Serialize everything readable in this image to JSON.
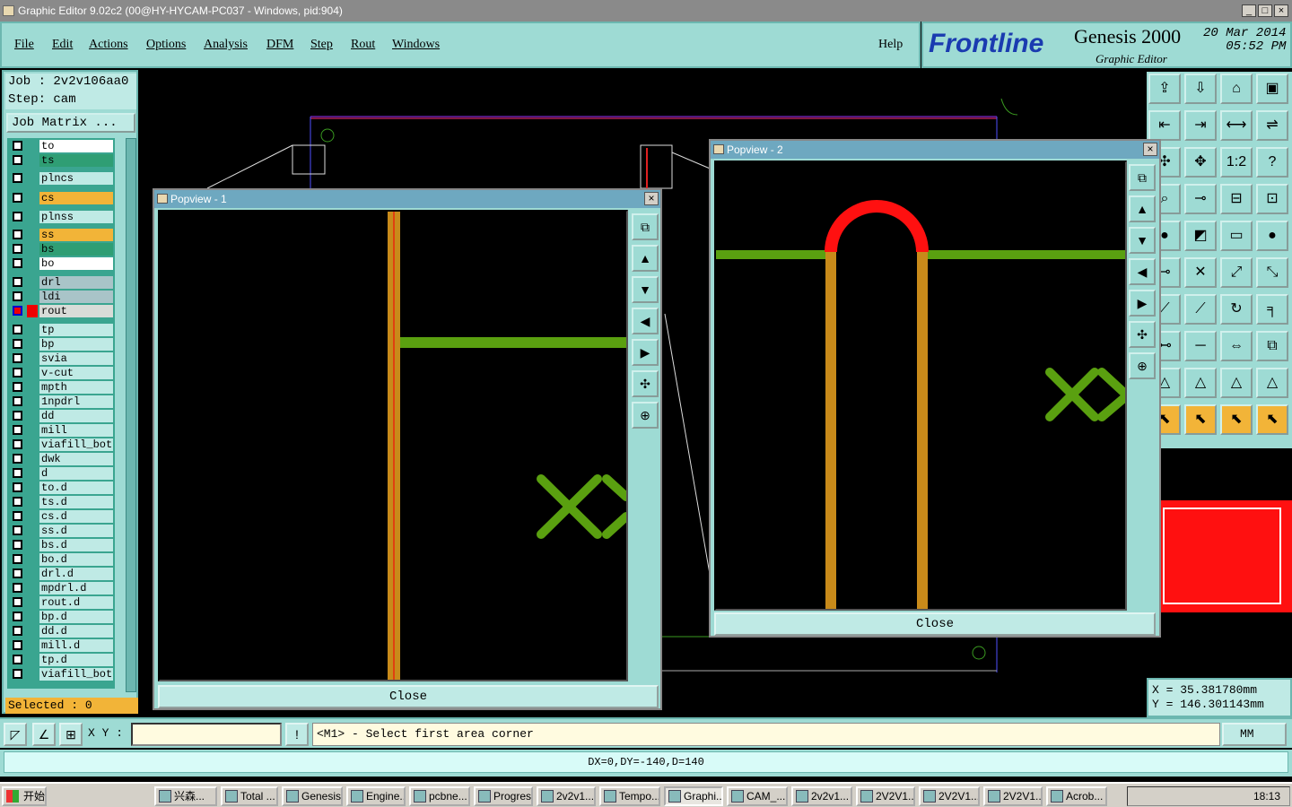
{
  "window": {
    "title": "Graphic Editor 9.02c2 (00@HY-HYCAM-PC037 - Windows, pid:904)",
    "buttons": [
      "_",
      "□",
      "×"
    ]
  },
  "menu": {
    "items": [
      "File",
      "Edit",
      "Actions",
      "Options",
      "Analysis",
      "DFM",
      "Step",
      "Rout",
      "Windows"
    ],
    "help": "Help"
  },
  "brand": {
    "logo": "Frontline",
    "product": "Genesis 2000",
    "subtitle": "Graphic Editor",
    "date": "20 Mar 2014",
    "time": "05:52 PM"
  },
  "job": {
    "job_label": "Job : 2v2v106aa0",
    "step_label": "Step: cam",
    "matrix_button": "Job Matrix ..."
  },
  "layers": [
    {
      "name": "to",
      "color": "#ffffff"
    },
    {
      "name": "ts",
      "color": "#2f9e74"
    },
    {
      "name": "plncs",
      "color": "#bfeae5"
    },
    {
      "name": "cs",
      "color": "#f2b438"
    },
    {
      "name": "plnss",
      "color": "#bfeae5"
    },
    {
      "name": "ss",
      "color": "#f2b438"
    },
    {
      "name": "bs",
      "color": "#2f9e74"
    },
    {
      "name": "bo",
      "color": "#ffffff"
    },
    {
      "name": "drl",
      "color": "#a9c4c8"
    },
    {
      "name": "ldi",
      "color": "#a9c4c8"
    },
    {
      "name": "rout",
      "color": "#d8dcd8",
      "selected": true
    },
    {
      "name": "tp",
      "color": "#bfeae5"
    },
    {
      "name": "bp",
      "color": "#bfeae5"
    },
    {
      "name": "svia",
      "color": "#bfeae5"
    },
    {
      "name": "v-cut",
      "color": "#bfeae5"
    },
    {
      "name": "mpth",
      "color": "#bfeae5"
    },
    {
      "name": "1npdrl",
      "color": "#bfeae5"
    },
    {
      "name": "dd",
      "color": "#bfeae5"
    },
    {
      "name": "mill",
      "color": "#bfeae5"
    },
    {
      "name": "viafill_bot",
      "color": "#bfeae5"
    },
    {
      "name": "dwk",
      "color": "#bfeae5"
    },
    {
      "name": "d",
      "color": "#bfeae5"
    },
    {
      "name": "to.d",
      "color": "#bfeae5"
    },
    {
      "name": "ts.d",
      "color": "#bfeae5"
    },
    {
      "name": "cs.d",
      "color": "#bfeae5"
    },
    {
      "name": "ss.d",
      "color": "#bfeae5"
    },
    {
      "name": "bs.d",
      "color": "#bfeae5"
    },
    {
      "name": "bo.d",
      "color": "#bfeae5"
    },
    {
      "name": "drl.d",
      "color": "#bfeae5"
    },
    {
      "name": "mpdrl.d",
      "color": "#bfeae5"
    },
    {
      "name": "rout.d",
      "color": "#bfeae5"
    },
    {
      "name": "bp.d",
      "color": "#bfeae5"
    },
    {
      "name": "dd.d",
      "color": "#bfeae5"
    },
    {
      "name": "mill.d",
      "color": "#bfeae5"
    },
    {
      "name": "tp.d",
      "color": "#bfeae5"
    },
    {
      "name": "viafill_bot",
      "color": "#bfeae5"
    }
  ],
  "selected": "Selected : 0",
  "popview1": {
    "title": "Popview - 1",
    "close": "Close"
  },
  "popview2": {
    "title": "Popview - 2",
    "close": "Close"
  },
  "coords": {
    "x": "X = 35.381780mm",
    "y": "Y = 146.301143mm"
  },
  "command": {
    "xy_label": "X Y :",
    "xy_value": "",
    "prompt": "<M1> - Select first area corner",
    "units": "MM"
  },
  "status": "DX=0,DY=-140,D=140",
  "taskbar": {
    "start": "开始",
    "tasks": [
      "兴森...",
      "Total ...",
      "Genesis",
      "Engine...",
      "pcbne...",
      "Progress",
      "2v2v1...",
      "Tempo...",
      "Graphi...",
      "CAM_...",
      "2v2v1...",
      "2V2V1...",
      "2V2V1...",
      "2V2V1...",
      "Acrob..."
    ],
    "clock": "18:13"
  },
  "colors": {
    "panel": "#9edbd4",
    "layer_active": "#f2b438",
    "trace_green": "#5aa010",
    "trace_orange": "#c88a1a",
    "arc_red": "#ff1010"
  }
}
